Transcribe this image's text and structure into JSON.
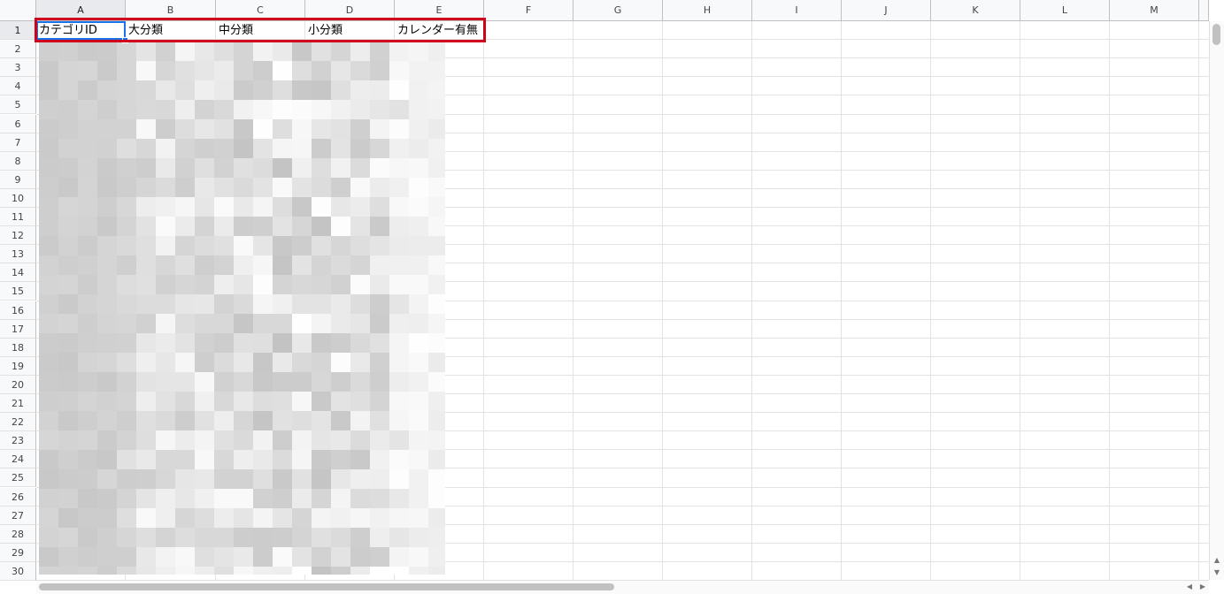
{
  "columns": [
    "A",
    "B",
    "C",
    "D",
    "E",
    "F",
    "G",
    "H",
    "I",
    "J",
    "K",
    "L",
    "M"
  ],
  "rows": [
    "1",
    "2",
    "3",
    "4",
    "5",
    "6",
    "7",
    "8",
    "9",
    "10",
    "11",
    "12",
    "13",
    "14",
    "15",
    "16",
    "17",
    "18",
    "19",
    "20",
    "21",
    "22",
    "23",
    "24",
    "25",
    "26",
    "27",
    "28",
    "29",
    "30"
  ],
  "header_cells": [
    "カテゴリID",
    "大分類",
    "中分類",
    "小分類",
    "カレンダー有無"
  ],
  "selected_cell": "A1",
  "colors": {
    "highlight_border": "#d0021b",
    "selection": "#1a73e8",
    "grid": "#e2e3e3",
    "header_bg": "#f8f9fa"
  },
  "icons": {
    "scroll_up": "▲",
    "scroll_down": "▼",
    "scroll_left": "◀",
    "scroll_right": "▶"
  }
}
